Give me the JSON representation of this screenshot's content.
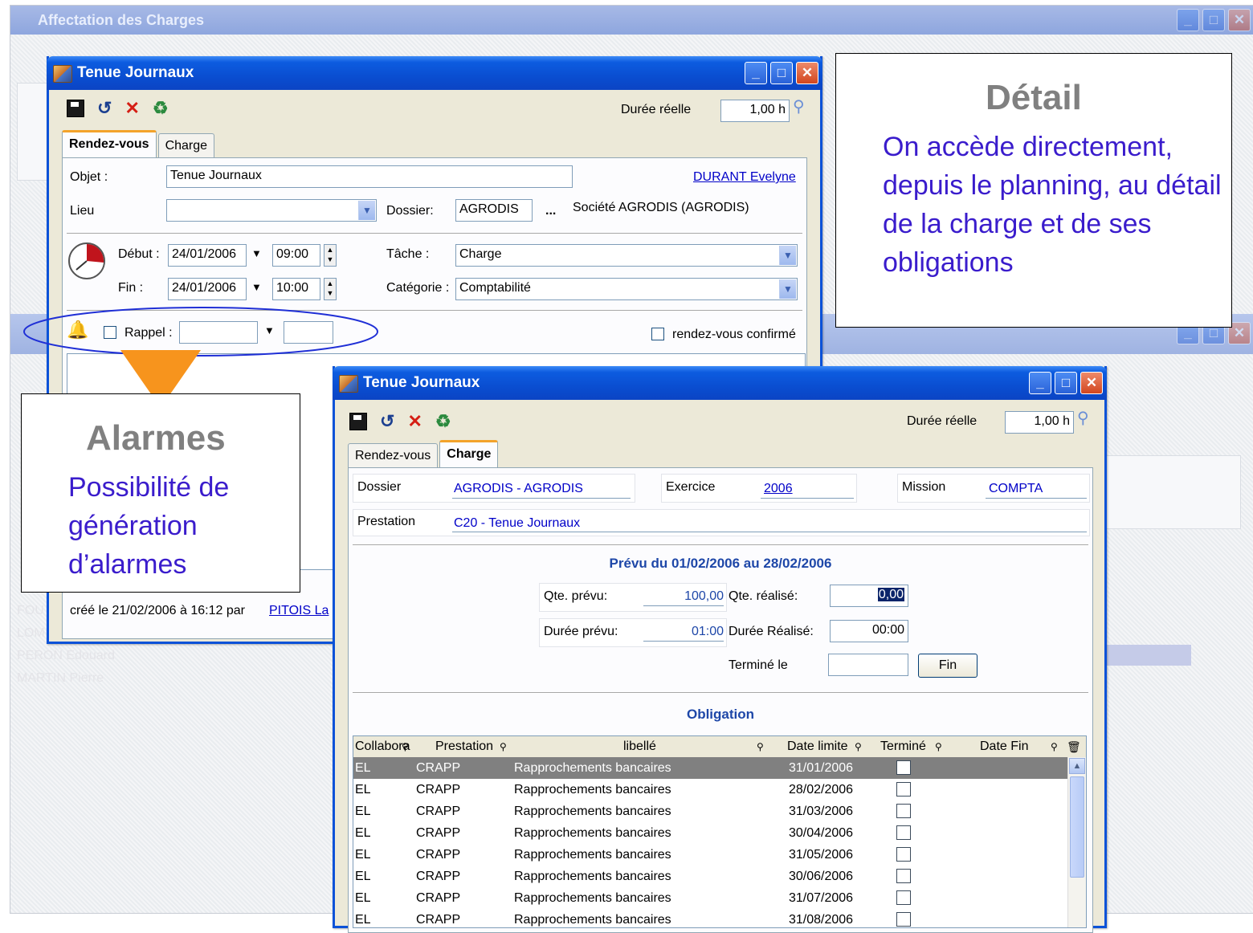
{
  "background_window": {
    "title": "Affectation des Charges",
    "names": [
      "FOU",
      "LOM",
      "PERON Edouard",
      "MARTIN Pierre"
    ]
  },
  "window1": {
    "title": "Tenue Journaux",
    "duree_label": "Durée réelle",
    "duree_value": "1,00 h",
    "tabs": [
      {
        "label": "Rendez-vous",
        "active": true
      },
      {
        "label": "Charge",
        "active": false
      }
    ],
    "objet_label": "Objet :",
    "objet_value": "Tenue Journaux",
    "owner_link": "DURANT Evelyne",
    "lieu_label": "Lieu",
    "lieu_value": "",
    "dossier_label": "Dossier:",
    "dossier_value": "AGRODIS",
    "dossier_more": "...",
    "dossier_desc": "Société AGRODIS (AGRODIS)",
    "debut_label": "Début :",
    "debut_date": "24/01/2006",
    "debut_time": "09:00",
    "fin_label": "Fin :",
    "fin_date": "24/01/2006",
    "fin_time": "10:00",
    "tache_label": "Tâche :",
    "tache_value": "Charge",
    "categorie_label": "Catégorie :",
    "categorie_value": "Comptabilité",
    "rappel_label": "Rappel :",
    "rappel_date": "",
    "rappel_time": "",
    "confirme_label": "rendez-vous confirmé",
    "footer_text": "créé le 21/02/2006 à 16:12 par",
    "footer_link": "PITOIS La"
  },
  "window2": {
    "title": "Tenue Journaux",
    "duree_label": "Durée réelle",
    "duree_value": "1,00 h",
    "tabs": [
      {
        "label": "Rendez-vous",
        "active": false
      },
      {
        "label": "Charge",
        "active": true
      }
    ],
    "dossier_label": "Dossier",
    "dossier_value": "AGRODIS - AGRODIS",
    "exercice_label": "Exercice",
    "exercice_value": "2006",
    "mission_label": "Mission",
    "mission_value": "COMPTA",
    "prestation_label": "Prestation",
    "prestation_value": "C20 - Tenue Journaux",
    "prevu_heading": "Prévu du 01/02/2006 au 28/02/2006",
    "qte_prevu_label": "Qte. prévu:",
    "qte_prevu_value": "100,00",
    "qte_realise_label": "Qte. réalisé:",
    "qte_realise_value": "0,00",
    "duree_prevu_label": "Durée prévu:",
    "duree_prevu_value": "01:00",
    "duree_realise_label": "Durée Réalisé:",
    "duree_realise_value": "00:00",
    "termine_label": "Terminé le",
    "termine_value": "",
    "fin_button": "Fin",
    "obligation_heading": "Obligation",
    "columns": [
      "Collabora",
      "Prestation",
      "libellé",
      "Date limite",
      "Terminé",
      "Date Fin"
    ],
    "rows": [
      {
        "collab": "EL",
        "prestation": "CRAPP",
        "libelle": "Rapprochements bancaires",
        "date_limite": "31/01/2006",
        "selected": true
      },
      {
        "collab": "EL",
        "prestation": "CRAPP",
        "libelle": "Rapprochements bancaires",
        "date_limite": "28/02/2006",
        "selected": false
      },
      {
        "collab": "EL",
        "prestation": "CRAPP",
        "libelle": "Rapprochements bancaires",
        "date_limite": "31/03/2006",
        "selected": false
      },
      {
        "collab": "EL",
        "prestation": "CRAPP",
        "libelle": "Rapprochements bancaires",
        "date_limite": "30/04/2006",
        "selected": false
      },
      {
        "collab": "EL",
        "prestation": "CRAPP",
        "libelle": "Rapprochements bancaires",
        "date_limite": "31/05/2006",
        "selected": false
      },
      {
        "collab": "EL",
        "prestation": "CRAPP",
        "libelle": "Rapprochements bancaires",
        "date_limite": "30/06/2006",
        "selected": false
      },
      {
        "collab": "EL",
        "prestation": "CRAPP",
        "libelle": "Rapprochements bancaires",
        "date_limite": "31/07/2006",
        "selected": false
      },
      {
        "collab": "EL",
        "prestation": "CRAPP",
        "libelle": "Rapprochements bancaires",
        "date_limite": "31/08/2006",
        "selected": false
      }
    ]
  },
  "callout_detail": {
    "title": "Détail",
    "text": "On accède directement, depuis le planning, au détail de la charge et de ses obligations"
  },
  "callout_alarmes": {
    "title": "Alarmes",
    "text": "Possibilité de génération d’alarmes"
  },
  "colors": {
    "callout_text": "#3a1ccc",
    "callout_title": "#808080",
    "arrow": "#f7941d",
    "ellipse": "#1f2fd6",
    "xp_title": "#0a4ed1"
  }
}
